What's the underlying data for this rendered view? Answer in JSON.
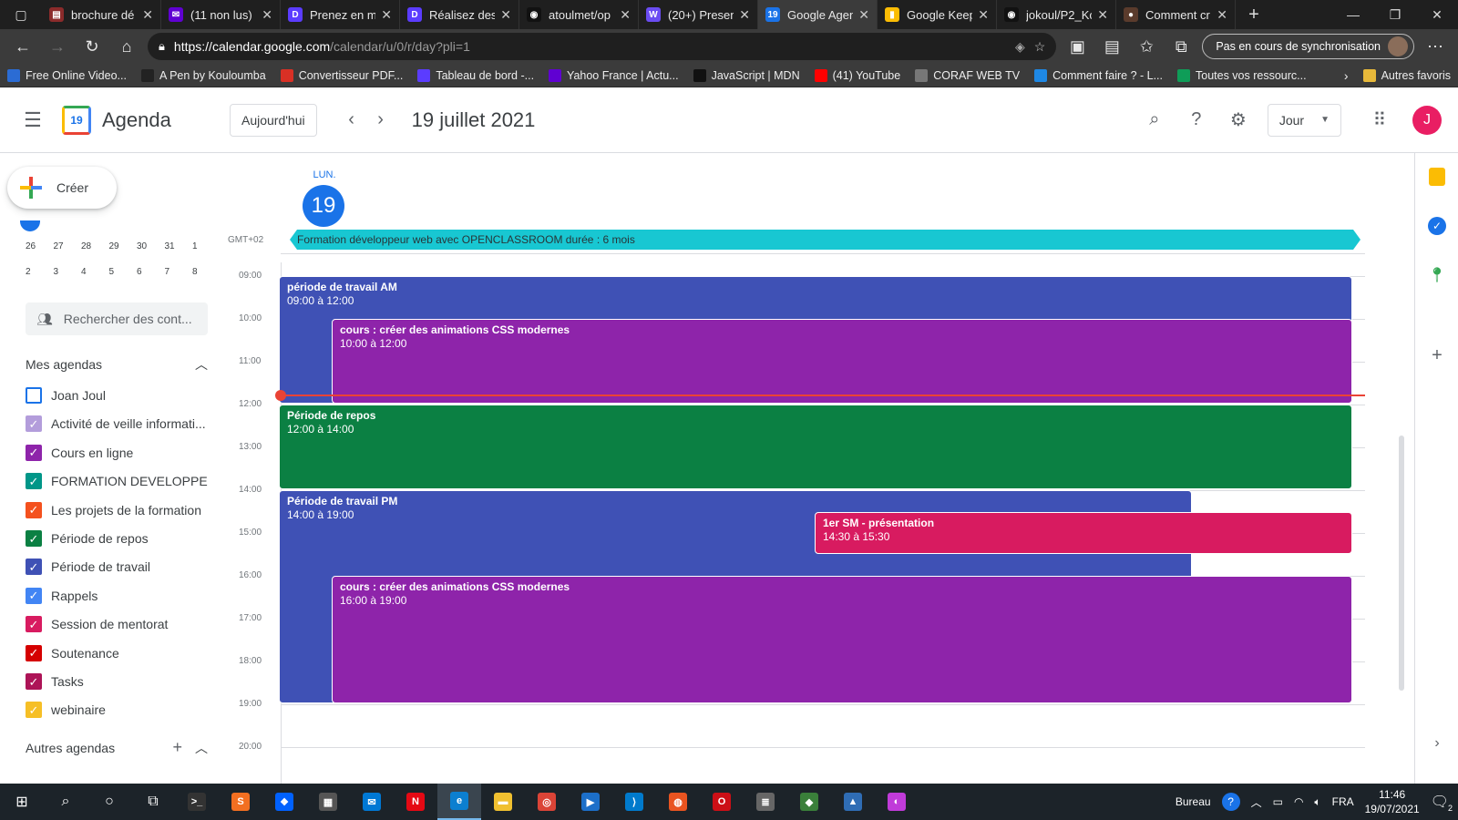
{
  "browser": {
    "tabs": [
      {
        "title": "brochure dé",
        "color": "#8b2b2b",
        "glyph": "▤"
      },
      {
        "title": "(11 non lus)",
        "color": "#6001d2",
        "glyph": "✉"
      },
      {
        "title": "Prenez en m",
        "color": "#5b3cff",
        "glyph": "D"
      },
      {
        "title": "Réalisez des",
        "color": "#5b3cff",
        "glyph": "D"
      },
      {
        "title": "atoulmet/op",
        "color": "#111111",
        "glyph": "◉"
      },
      {
        "title": "(20+) Presen",
        "color": "#6a4cf2",
        "glyph": "W"
      },
      {
        "title": "Google Agen",
        "color": "#1a73e8",
        "glyph": "19",
        "active": true
      },
      {
        "title": "Google Keep",
        "color": "#fbbc04",
        "glyph": "▮"
      },
      {
        "title": "jokoul/P2_Kc",
        "color": "#111111",
        "glyph": "◉"
      },
      {
        "title": "Comment cr",
        "color": "#5a3b2c",
        "glyph": "●"
      }
    ],
    "url_host": "https://calendar.google.com",
    "url_path": "/calendar/u/0/r/day?pli=1",
    "sync_label": "Pas en cours de synchronisation",
    "bookmarks": [
      {
        "label": "Free Online Video...",
        "color": "#2b6cd4"
      },
      {
        "label": "A Pen by Kouloumba",
        "color": "#222222"
      },
      {
        "label": "Convertisseur PDF...",
        "color": "#d93025"
      },
      {
        "label": "Tableau de bord -...",
        "color": "#5b3cff"
      },
      {
        "label": "Yahoo France | Actu...",
        "color": "#6001d2"
      },
      {
        "label": "JavaScript | MDN",
        "color": "#111111"
      },
      {
        "label": "(41) YouTube",
        "color": "#ff0000"
      },
      {
        "label": "CORAF WEB TV",
        "color": "#777777"
      },
      {
        "label": "Comment faire ? - L...",
        "color": "#1e88e5"
      },
      {
        "label": "Toutes vos ressourc...",
        "color": "#0f9d58"
      }
    ],
    "other_favorites": "Autres favoris"
  },
  "header": {
    "app_name": "Agenda",
    "logo_text": "19",
    "today_button": "Aujourd'hui",
    "date_title": "19 juillet 2021",
    "view_button": "Jour",
    "user_initial": "J"
  },
  "sidebar": {
    "create_label": "Créer",
    "mini_calendar": {
      "row1": [
        "26",
        "27",
        "28",
        "29",
        "30",
        "31",
        "1"
      ],
      "row2": [
        "2",
        "3",
        "4",
        "5",
        "6",
        "7",
        "8"
      ]
    },
    "search_placeholder": "Rechercher des cont...",
    "my_calendars_title": "Mes agendas",
    "my_calendars": [
      {
        "label": "Joan Joul",
        "color": "#1a73e8",
        "checked": false
      },
      {
        "label": "Activité de veille informati...",
        "color": "#b39ddb",
        "checked": true
      },
      {
        "label": "Cours en ligne",
        "color": "#8e24aa",
        "checked": true
      },
      {
        "label": "FORMATION DEVELOPPE...",
        "color": "#009688",
        "checked": true
      },
      {
        "label": "Les projets de la formation",
        "color": "#f4511e",
        "checked": true
      },
      {
        "label": "Période de repos",
        "color": "#0b8043",
        "checked": true
      },
      {
        "label": "Période de travail",
        "color": "#3f51b5",
        "checked": true
      },
      {
        "label": "Rappels",
        "color": "#4285f4",
        "checked": true
      },
      {
        "label": "Session de mentorat",
        "color": "#d81b60",
        "checked": true
      },
      {
        "label": "Soutenance",
        "color": "#d50000",
        "checked": true
      },
      {
        "label": "Tasks",
        "color": "#ad1457",
        "checked": true
      },
      {
        "label": "webinaire",
        "color": "#f6bf26",
        "checked": true
      }
    ],
    "other_calendars_title": "Autres agendas"
  },
  "day": {
    "weekday": "LUN.",
    "number": "19",
    "timezone": "GMT+02",
    "all_day_event": "Formation développeur web avec OPENCLASSROOM durée : 6 mois",
    "all_day_color": "#18c7d2",
    "hours": [
      "09:00",
      "10:00",
      "11:00",
      "12:00",
      "13:00",
      "14:00",
      "15:00",
      "16:00",
      "17:00",
      "18:00",
      "19:00",
      "20:00"
    ],
    "current_time": "11:46",
    "events": [
      {
        "title": "période de travail AM",
        "time": "09:00 à 12:00",
        "start": 9,
        "end": 12,
        "color": "#3f51b5",
        "lane": "full"
      },
      {
        "title": "cours : créer des animations CSS modernes",
        "time": "10:00 à 12:00",
        "start": 10,
        "end": 12,
        "color": "#8e24aa",
        "lane": "overlap"
      },
      {
        "title": "Période de repos",
        "time": "12:00 à 14:00",
        "start": 12,
        "end": 14,
        "color": "#0b8043",
        "lane": "full"
      },
      {
        "title": "Période de travail PM",
        "time": "14:00 à 19:00",
        "start": 14,
        "end": 19,
        "color": "#3f51b5",
        "lane": "pm"
      },
      {
        "title": "1er SM - présentation",
        "time": "14:30 à 15:30",
        "start": 14.5,
        "end": 15.5,
        "color": "#d81b60",
        "lane": "right"
      },
      {
        "title": "cours : créer des animations CSS modernes",
        "time": "16:00 à 19:00",
        "start": 16,
        "end": 19,
        "color": "#8e24aa",
        "lane": "overlap"
      }
    ]
  },
  "taskbar": {
    "apps": [
      {
        "name": "terminal",
        "color": "#333333",
        "glyph": ">_"
      },
      {
        "name": "sublime",
        "color": "#f26f21",
        "glyph": "S"
      },
      {
        "name": "dropbox",
        "color": "#0061fe",
        "glyph": "❖"
      },
      {
        "name": "store",
        "color": "#555555",
        "glyph": "▦"
      },
      {
        "name": "mail",
        "color": "#0078d4",
        "glyph": "✉"
      },
      {
        "name": "netflix",
        "color": "#e50914",
        "glyph": "N"
      },
      {
        "name": "edge",
        "color": "#0c7fd0",
        "glyph": "e",
        "active": true
      },
      {
        "name": "explorer",
        "color": "#f0c030",
        "glyph": "▬"
      },
      {
        "name": "chrome",
        "color": "#db4437",
        "glyph": "◎"
      },
      {
        "name": "media",
        "color": "#1c6fc9",
        "glyph": "▶"
      },
      {
        "name": "vscode",
        "color": "#007acc",
        "glyph": "⟩"
      },
      {
        "name": "ubuntu",
        "color": "#e95420",
        "glyph": "◍"
      },
      {
        "name": "opera",
        "color": "#cc0f16",
        "glyph": "O"
      },
      {
        "name": "notes",
        "color": "#666666",
        "glyph": "≣"
      },
      {
        "name": "git",
        "color": "#3a7f3a",
        "glyph": "◆"
      },
      {
        "name": "photos",
        "color": "#2f6db5",
        "glyph": "▲"
      },
      {
        "name": "paint",
        "color": "#c03bd9",
        "glyph": "◐"
      }
    ],
    "desktop_label": "Bureau",
    "language": "FRA",
    "time": "11:46",
    "date": "19/07/2021",
    "notifications": "2"
  }
}
